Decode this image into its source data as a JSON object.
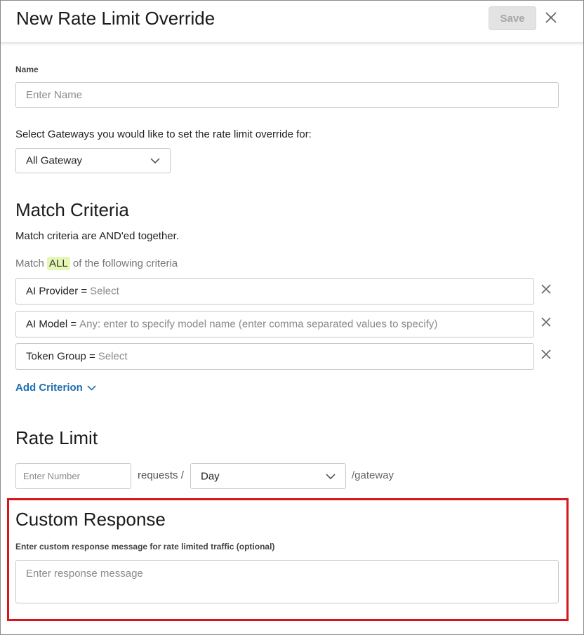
{
  "header": {
    "title": "New Rate Limit Override",
    "save_label": "Save"
  },
  "name_field": {
    "label": "Name",
    "placeholder": "Enter Name"
  },
  "gateways": {
    "prompt": "Select Gateways you would like to set the rate limit override for:",
    "selected": "All Gateway"
  },
  "match_criteria": {
    "heading": "Match Criteria",
    "description": "Match criteria are AND'ed together.",
    "match_prefix": "Match",
    "match_mode": "ALL",
    "match_suffix": "of the following criteria",
    "criteria": [
      {
        "key": "AI Provider =",
        "value": "Select"
      },
      {
        "key": "AI Model =",
        "value": "Any: enter to specify model name (enter comma separated values to specify)"
      },
      {
        "key": "Token Group =",
        "value": "Select"
      }
    ],
    "add_label": "Add Criterion"
  },
  "rate_limit": {
    "heading": "Rate Limit",
    "number_placeholder": "Enter Number",
    "requests_label": "requests /",
    "period_selected": "Day",
    "scope_label": "/gateway"
  },
  "custom_response": {
    "heading": "Custom Response",
    "label": "Enter custom response message for rate limited traffic (optional)",
    "placeholder": "Enter response message"
  },
  "colors": {
    "link": "#1f6fb0",
    "highlight_border": "#d9141b",
    "all_badge_bg": "#e4f7b5",
    "save_disabled_bg": "#e3e3e3"
  }
}
